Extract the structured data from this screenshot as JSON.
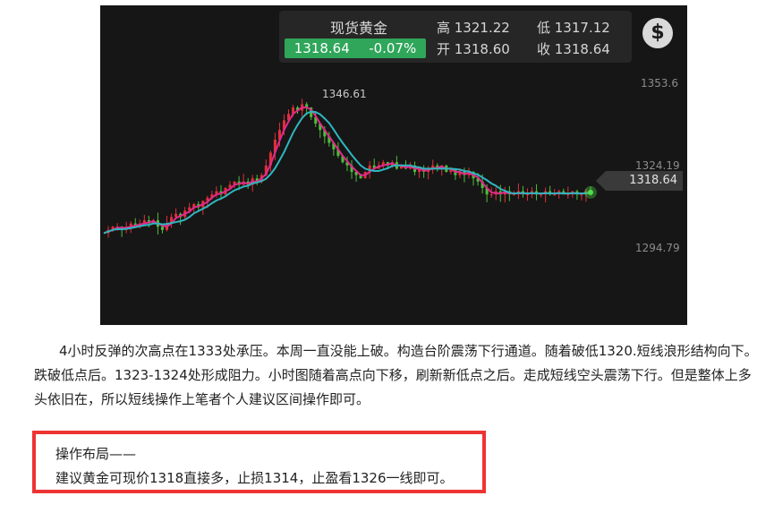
{
  "ticker": {
    "name": "现货黄金",
    "price": "1318.64",
    "change": "-0.07%",
    "high": "高 1321.22",
    "low": "低 1317.12",
    "open": "开 1318.60",
    "close": "收 1318.64",
    "currency_icon": "$"
  },
  "chart_data": {
    "type": "line",
    "y_axis_labels": [
      "1353.6",
      "1324.19",
      "1294.79"
    ],
    "current_price_label": "1318.64",
    "peak_label": "1346.61",
    "ylim": [
      1285,
      1360
    ],
    "colors": {
      "background": "#161616",
      "up_candle": "#e0303a",
      "down_candle": "#4cbf3a",
      "ma_fast": "#e02a8c",
      "ma_slow": "#2fb6c0",
      "last_point": "#4cdf4a"
    },
    "x": [
      0,
      5,
      10,
      15,
      20,
      25,
      30,
      35,
      40,
      45,
      50,
      55,
      60,
      65,
      70,
      75,
      80,
      85,
      90,
      95,
      100,
      105,
      110,
      115,
      120,
      125,
      130,
      135,
      140,
      145,
      150,
      155,
      160,
      165,
      170,
      175,
      180,
      185,
      190,
      195,
      200,
      205,
      210,
      215,
      220,
      225,
      230,
      235,
      240,
      245,
      250,
      255,
      260,
      265,
      270,
      275,
      280,
      285,
      290,
      295,
      300,
      305,
      310,
      315,
      320,
      325,
      330,
      335,
      340,
      345,
      350,
      355,
      360,
      365,
      370,
      375,
      380,
      385,
      390,
      395,
      400,
      405,
      410,
      415,
      420,
      425,
      430,
      435,
      440,
      445,
      450,
      455,
      460,
      465,
      470,
      475,
      480,
      485,
      490,
      495,
      500,
      505,
      510,
      515,
      520,
      525,
      530,
      535,
      540
    ],
    "series": [
      {
        "values": [
          1306,
          1307,
          1308,
          1308,
          1307,
          1308,
          1309,
          1308,
          1309,
          1310,
          1309,
          1310,
          1308,
          1307,
          1309,
          1311,
          1312,
          1311,
          1313,
          1314,
          1315,
          1314,
          1316,
          1317,
          1318,
          1319,
          1318,
          1320,
          1321,
          1322,
          1321,
          1322,
          1321,
          1323,
          1322,
          1324,
          1327,
          1331,
          1335,
          1338,
          1341,
          1343,
          1345,
          1344,
          1346,
          1345,
          1342,
          1340,
          1338,
          1336,
          1334,
          1332,
          1330,
          1328,
          1327,
          1325,
          1324,
          1323,
          1325,
          1327,
          1326,
          1327,
          1328,
          1327,
          1328,
          1326,
          1327,
          1326,
          1327,
          1325,
          1326,
          1325,
          1326,
          1327,
          1326,
          1327,
          1325,
          1326,
          1324,
          1325,
          1324,
          1325,
          1323,
          1322,
          1320,
          1318,
          1318,
          1319,
          1318,
          1319,
          1318,
          1318,
          1319,
          1318,
          1318,
          1319,
          1318,
          1318,
          1319,
          1318,
          1318,
          1319,
          1318,
          1318,
          1319,
          1318,
          1318,
          1319,
          1318.64
        ]
      }
    ]
  },
  "article": {
    "paragraph": "4小时反弹的次高点在1333处承压。本周一直没能上破。构造台阶震荡下行通道。随着破低1320.短线浪形结构向下。跌破低点后。1323-1324处形成阻力。小时图随着高点向下移，刷新新低点之后。走成短线空头震荡下行。但是整体上多头依旧在，所以短线操作上笔者个人建议区间操作即可。"
  },
  "plan": {
    "title": "操作布局——",
    "body": "建议黄金可现价1318直接多，止损1314，止盈看1326一线即可。"
  }
}
